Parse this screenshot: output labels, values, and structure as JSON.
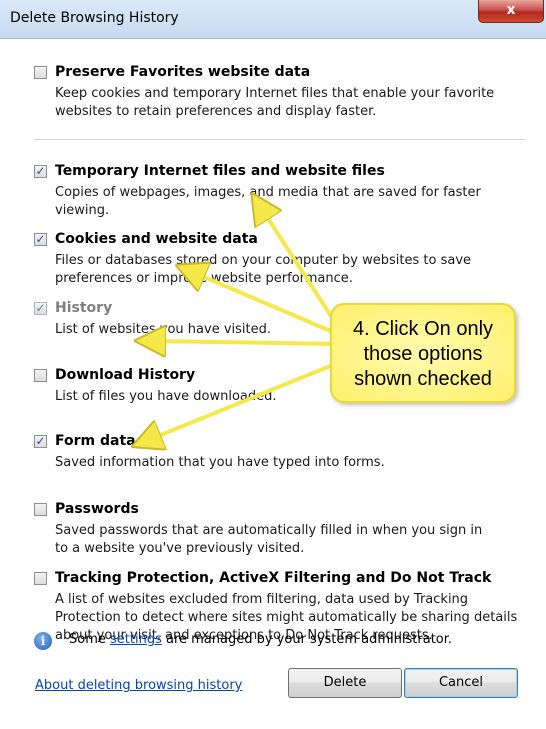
{
  "window": {
    "title": "Delete Browsing History",
    "close_label": "x"
  },
  "options": [
    {
      "title": "Preserve Favorites website data",
      "desc_line1": "Keep cookies and temporary Internet files that enable your favorite",
      "desc_line2": "websites to retain preferences and display faster.",
      "checked": false
    },
    {
      "title": "Temporary Internet files and website files",
      "desc_line1": "Copies of webpages, images, and media that are saved for faster",
      "desc_line2": "viewing.",
      "checked": true
    },
    {
      "title": "Cookies and website data",
      "desc_line1": "Files or databases stored on your computer by websites to save",
      "desc_line2": "preferences or improve website performance.",
      "checked": true
    },
    {
      "title": "History",
      "desc_line1": "List of websites you have visited.",
      "checked": true,
      "disabled": true
    },
    {
      "title": "Download History",
      "desc_line1": "List of files you have downloaded.",
      "checked": false
    },
    {
      "title": "Form data",
      "desc_line1": "Saved information that you have typed into forms.",
      "checked": true
    },
    {
      "title": "Passwords",
      "desc_line1": "Saved passwords that are automatically filled in when you sign in",
      "desc_line2": "to a website you've previously visited.",
      "checked": false
    },
    {
      "title": "Tracking Protection, ActiveX Filtering and Do Not Track",
      "desc_line1": "A list of websites excluded from filtering, data used by Tracking",
      "desc_line2": "Protection to detect where sites might automatically be sharing details",
      "desc_line3": "about your visit, and exceptions to Do Not Track requests.",
      "checked": false
    }
  ],
  "checkmark": "✓",
  "info": {
    "icon": "info-icon",
    "text_before": "Some ",
    "link_text": "settings",
    "text_after": " are managed by your system administrator."
  },
  "footer": {
    "about_link": "About deleting browsing history",
    "delete_label": "Delete",
    "cancel_label": "Cancel"
  },
  "callout": {
    "line1": "4. Click On only",
    "line2": "those options",
    "line3": "shown checked"
  },
  "colors": {
    "callout_fill": "#fff06a",
    "arrow": "#f5e94a",
    "link": "#0645ad"
  }
}
